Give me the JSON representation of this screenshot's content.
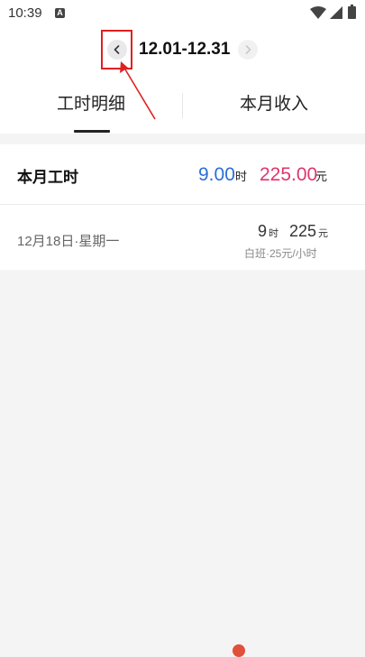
{
  "status_bar": {
    "time": "10:39",
    "notification_icon": "a-box-icon",
    "icons": [
      "wifi-icon",
      "signal-icon",
      "battery-icon"
    ]
  },
  "date_nav": {
    "range": "12.01-12.31",
    "prev_icon": "chevron-left-icon",
    "next_icon": "chevron-right-icon"
  },
  "tabs": [
    {
      "label": "工时明细",
      "selected": true
    },
    {
      "label": "本月收入",
      "selected": false
    }
  ],
  "summary": {
    "label": "本月工时",
    "hours": "9.00",
    "hours_unit": "时",
    "income": "225.00",
    "income_unit": "元"
  },
  "entries": [
    {
      "date": "12月18日·星期一",
      "hours": "9",
      "hours_unit": "时",
      "income": "225",
      "income_unit": "元",
      "shift": "白班·25元/小时"
    }
  ],
  "colors": {
    "hours": "#2a6fd6",
    "income": "#e0356b",
    "annotation": "#e02020"
  }
}
